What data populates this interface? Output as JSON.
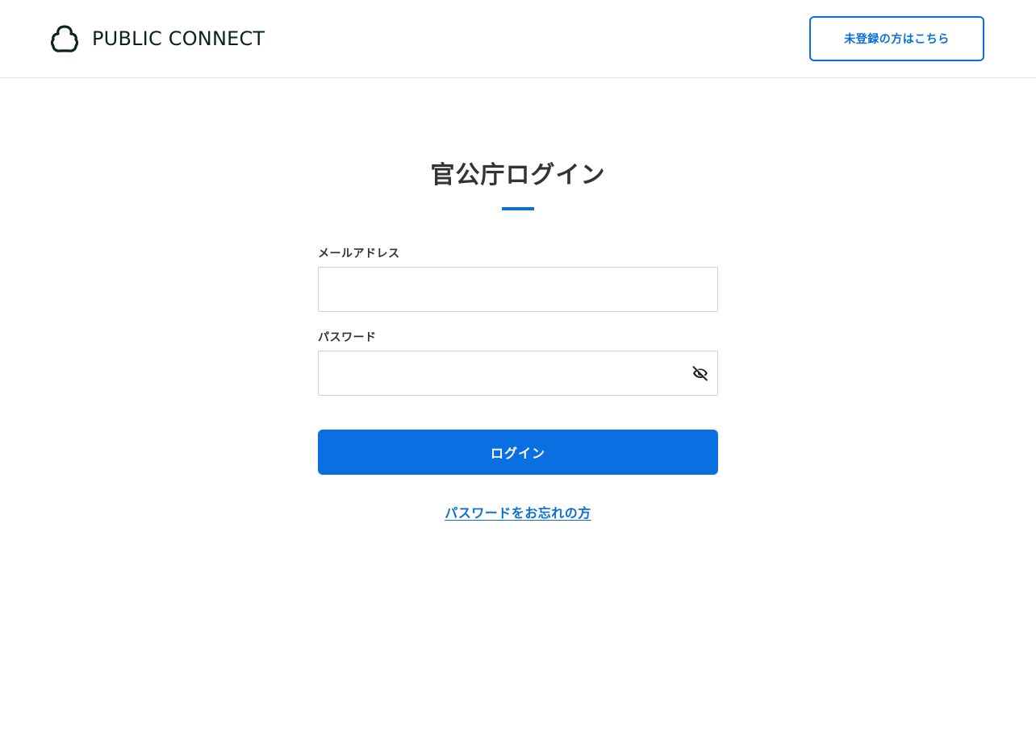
{
  "header": {
    "logo_text": "PUBLIC CONNECT",
    "logo_icon": "public-connect-logo-mark",
    "register_button_label": "未登録の方はこちら"
  },
  "main": {
    "title": "官公庁ログイン",
    "email": {
      "label": "メールアドレス",
      "value": "",
      "placeholder": ""
    },
    "password": {
      "label": "パスワード",
      "value": "",
      "placeholder": "",
      "toggle_icon": "eye-off-icon"
    },
    "login_button_label": "ログイン",
    "forgot_password_label": "パスワードをお忘れの方"
  },
  "colors": {
    "accent": "#0a6fd8",
    "primary_button": "#0a6fe0",
    "logo": "#0c2417",
    "text": "#333333",
    "border": "#d0d0d0"
  }
}
